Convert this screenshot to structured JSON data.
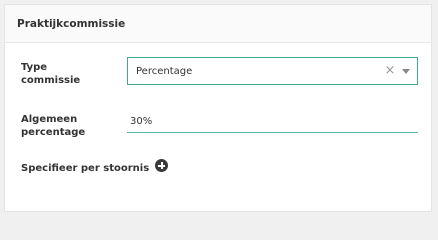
{
  "panel": {
    "title": "Praktijkcommissie"
  },
  "type_commissie": {
    "label_line1": "Type",
    "label_line2": "commissie",
    "selected_value": "Percentage",
    "clear_glyph": "×",
    "accent_color": "#41a98f"
  },
  "algemeen_percentage": {
    "label_line1": "Algemeen",
    "label_line2": "percentage",
    "value": "30%"
  },
  "specifieer": {
    "label": "Specifieer per stoornis",
    "icon": "plus-circle-icon"
  }
}
